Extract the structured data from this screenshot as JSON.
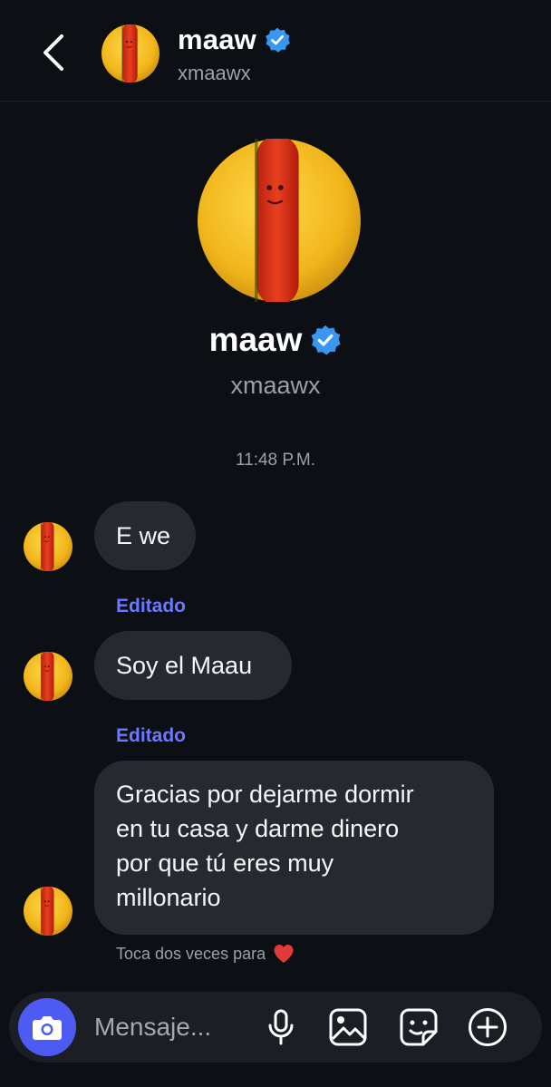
{
  "header": {
    "name": "maaw",
    "handle": "xmaawx"
  },
  "profile": {
    "name": "maaw",
    "handle": "xmaawx"
  },
  "timestamp": "11:48 P.M.",
  "messages": [
    {
      "text": "E we",
      "edited_label": ""
    },
    {
      "text": "Soy el Maau",
      "edited_label": "Editado"
    },
    {
      "lines": [
        "Gracias por dejarme dormir",
        "en tu casa y darme dinero",
        "por que tú eres muy",
        "millonario"
      ],
      "edited_label": "Editado"
    }
  ],
  "hint": "Toca dos veces para",
  "composer": {
    "placeholder": "Mensaje..."
  },
  "icons": {
    "back": "chevron-left-icon",
    "verified": "verified-badge-icon",
    "camera": "camera-icon",
    "mic": "microphone-icon",
    "gallery": "image-icon",
    "sticker": "sticker-icon",
    "add": "plus-circle-icon",
    "heart": "heart-icon"
  },
  "colors": {
    "background": "#0c0f14",
    "bubble": "#262a30",
    "verified": "#3897f0",
    "edited": "#6b78ff",
    "camera_button": "#4c5cf2",
    "heart": "#e03a3a"
  }
}
